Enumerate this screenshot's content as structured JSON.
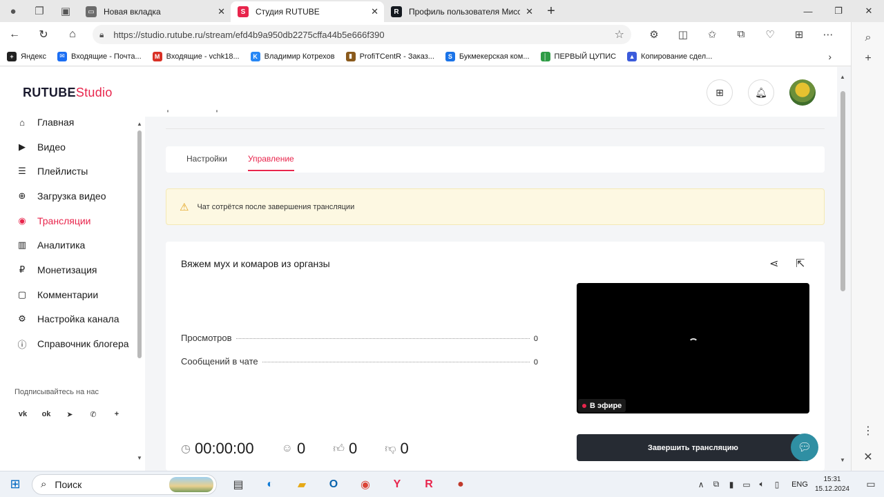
{
  "browser": {
    "tabs": [
      {
        "title": "Новая вкладка",
        "favicon_color": "#6b6b6b",
        "favicon_text": "▭",
        "active": false
      },
      {
        "title": "Студия RUTUBE",
        "favicon_color": "#e8254c",
        "favicon_text": "S",
        "active": true
      },
      {
        "title": "Профиль пользователя Миссия",
        "favicon_color": "#14191f",
        "favicon_text": "R",
        "active": false
      }
    ],
    "url": "https://studio.rutube.ru/stream/efd4b9a950db2275cffa44b5e666f390",
    "bookmarks": [
      {
        "label": "Яндекс",
        "color": "#222222",
        "icon": "+"
      },
      {
        "label": "Входящие - Почта...",
        "color": "#1b6ef3",
        "icon": "✉"
      },
      {
        "label": "Входящие - vchk18...",
        "color": "#d93025",
        "icon": "M"
      },
      {
        "label": "Владимир Котрехов",
        "color": "#2787f5",
        "icon": "K"
      },
      {
        "label": "ProfiTCentR - Заказ...",
        "color": "#8a5a1c",
        "icon": "▮"
      },
      {
        "label": "Букмекерская ком...",
        "color": "#1a73e8",
        "icon": "S"
      },
      {
        "label": "ПЕРВЫЙ ЦУПИС",
        "color": "#2e9c45",
        "icon": "│"
      },
      {
        "label": "Копирование сдел...",
        "color": "#3b5bdb",
        "icon": "▲"
      }
    ]
  },
  "studio": {
    "logo_main": "RUTUBE",
    "logo_studio": "Studio",
    "nav": [
      {
        "label": "Главная",
        "icon": "⌂"
      },
      {
        "label": "Видео",
        "icon": "▶"
      },
      {
        "label": "Плейлисты",
        "icon": "☰"
      },
      {
        "label": "Загрузка видео",
        "icon": "⊕"
      },
      {
        "label": "Трансляции",
        "icon": "((•))"
      },
      {
        "label": "Аналитика",
        "icon": "▥"
      },
      {
        "label": "Монетизация",
        "icon": "₽"
      },
      {
        "label": "Комментарии",
        "icon": "▢"
      },
      {
        "label": "Настройка канала",
        "icon": "⚙"
      },
      {
        "label": "Справочник блогера",
        "icon": "?"
      }
    ],
    "subscribe_label": "Подписывайтесь на нас",
    "socials": [
      "vk",
      "ok",
      "tg",
      "viber",
      "+"
    ],
    "page_tabs": [
      "Настройки",
      "Управление"
    ],
    "warning": "Чат сотрётся после завершения трансляции",
    "stream": {
      "title": "Вяжем мух и комаров из органзы",
      "stats": [
        {
          "label": "Просмотров",
          "value": "0"
        },
        {
          "label": "Сообщений в чате",
          "value": "0"
        }
      ],
      "live_label": "В эфире",
      "end_button": "Завершить трансляцию",
      "duration": "00:00:00",
      "viewers": "0",
      "likes": "0",
      "dislikes": "0"
    }
  },
  "taskbar": {
    "search_label": "Поиск",
    "lang": "ENG",
    "time": "15:31",
    "date": "15.12.2024"
  }
}
